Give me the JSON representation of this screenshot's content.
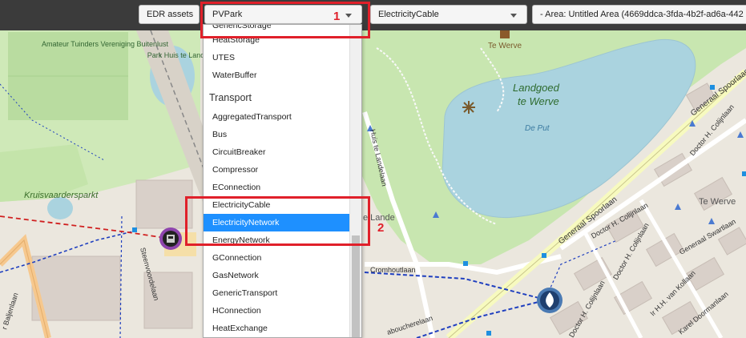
{
  "topbar": {
    "edr_assets_label": "EDR assets",
    "asset_select_value": "PVPark",
    "cable_select_value": "ElectricityCable",
    "area_text": "- Area: Untitled Area (4669ddca-3fda-4b2f-ad6a-442"
  },
  "dropdown": {
    "items_top": [
      "GenericStorage",
      "HeatStorage",
      "UTES",
      "WaterBuffer"
    ],
    "group_transport": "Transport",
    "items_transport": [
      "AggregatedTransport",
      "Bus",
      "CircuitBreaker",
      "Compressor",
      "EConnection",
      "ElectricityCable",
      "ElectricityNetwork",
      "EnergyNetwork",
      "GConnection",
      "GasNetwork",
      "GenericTransport",
      "HConnection",
      "HeatExchange"
    ],
    "selected_item": "ElectricityNetwork"
  },
  "annotations": {
    "label1": "1",
    "label2": "2"
  },
  "map_labels": {
    "park1": "Amateur Tuinders Vereniging Buitenlust",
    "park2": "Park Huis te Lande",
    "park3": "Kruisvaardersparkt",
    "landgoed": "Landgoed",
    "te_werve_estate": "te Werve",
    "de_put": "De Put",
    "te_werve_top": "Te Werve",
    "te_werve_right": "Te Werve",
    "lande": "e Lande",
    "huis_te_landelaan": "Huis te Landelaan",
    "generaal_spoorlaan_1": "Generaal Spoorlaan",
    "generaal_spoorlaan_2": "Generaal Spoorlaan",
    "generaal_spoorlaan_3": "Generaal Spoorlaan",
    "doctor_colijnlaan_1": "Doctor H. Colijnlaan",
    "doctor_colijnlaan_2": "Doctor H. Colijnlaan",
    "doctor_colijnlaan_3": "Doctor H. Colijnlaan",
    "doctor_colijnlaan_4": "Doctor H. Colijnlaan",
    "steenvoordelaan": "Steenvoordelaan",
    "cromhoutlaan": "Cromhoutlaan",
    "aboucherelaan": "aboucherelaan",
    "van_kollaan": "Ir H.H. van Kollaan",
    "swartlaan": "Generaal Swartlaan",
    "doormanlaan": "Karel Doormanlaan",
    "left_road": "r Baljenlaan"
  },
  "colors": {
    "accent_red": "#e0202a",
    "selected_blue": "#1e90ff",
    "water": "#aad3df",
    "park": "#c8e6b0",
    "cable_blue": "#1f3fbf",
    "cable_red": "#d02020"
  },
  "icons": {
    "asset_purple": "pv-park-icon",
    "asset_blue": "flame-icon",
    "castle": "castle-icon",
    "fountain": "fountain-icon"
  }
}
